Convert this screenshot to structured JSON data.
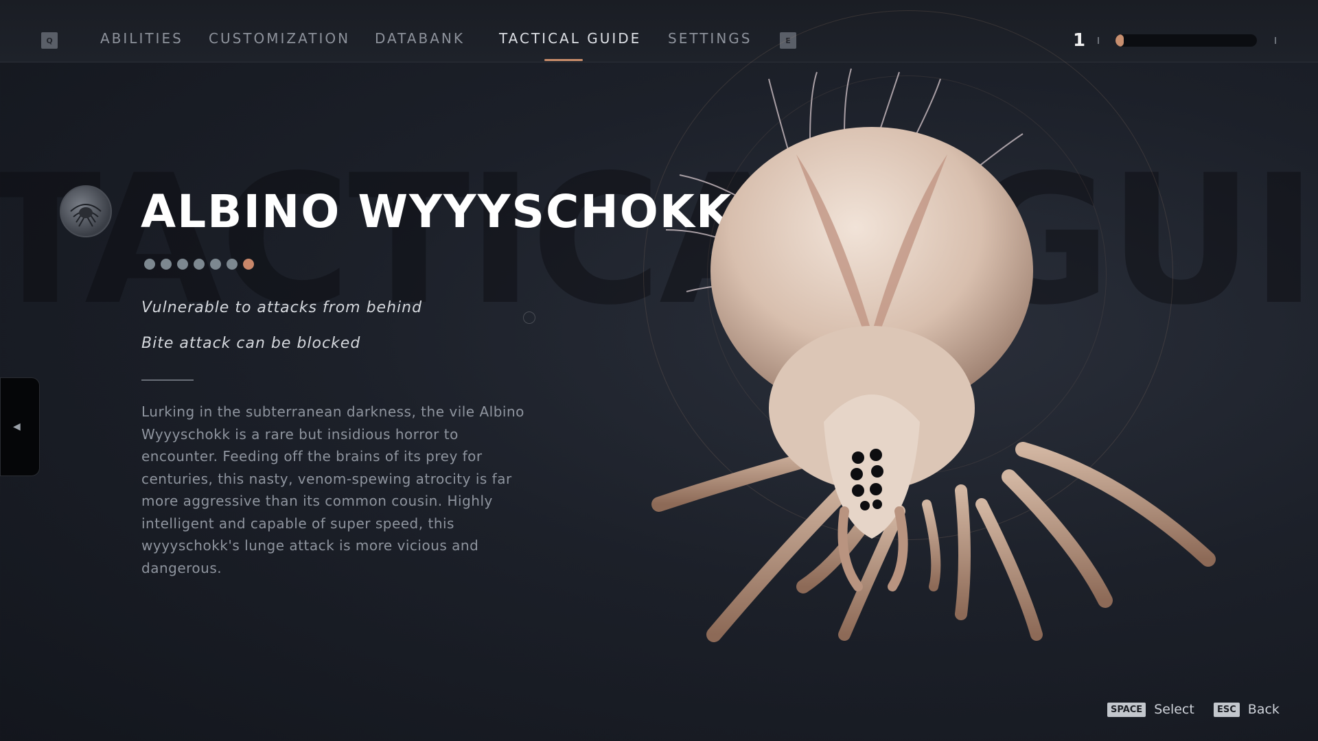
{
  "nav": {
    "left_key": "Q",
    "right_key": "E",
    "tabs": [
      {
        "label": "ABILITIES"
      },
      {
        "label": "CUSTOMIZATION"
      },
      {
        "label": "DATABANK"
      },
      {
        "label": "TACTICAL GUIDE"
      },
      {
        "label": "SETTINGS"
      }
    ],
    "active_tab": "TACTICAL GUIDE"
  },
  "status": {
    "level": "1",
    "xp_progress": 0.06,
    "accent_color": "#c98d6a"
  },
  "background_watermark": "TACTICAL GUIDE",
  "enemy": {
    "name": "ALBINO WYYYSCHOKK",
    "emblem_icon": "wyyyschokk-emblem-icon",
    "page_dots_total": 7,
    "page_dots_active_index": 6,
    "hints": [
      "Vulnerable to attacks from behind",
      "Bite attack can be blocked"
    ],
    "description": "Lurking in the subterranean darkness, the vile Albino Wyyyschokk is a rare but insidious horror to encounter. Feeding off the brains of its prey for centuries, this nasty, venom-spewing atrocity is far more aggressive than its common cousin. Highly intelligent and capable of super speed, this wyyyschokk's lunge attack is more vicious and dangerous."
  },
  "footer": {
    "select_key": "SPACE",
    "select_label": "Select",
    "back_key": "ESC",
    "back_label": "Back"
  }
}
